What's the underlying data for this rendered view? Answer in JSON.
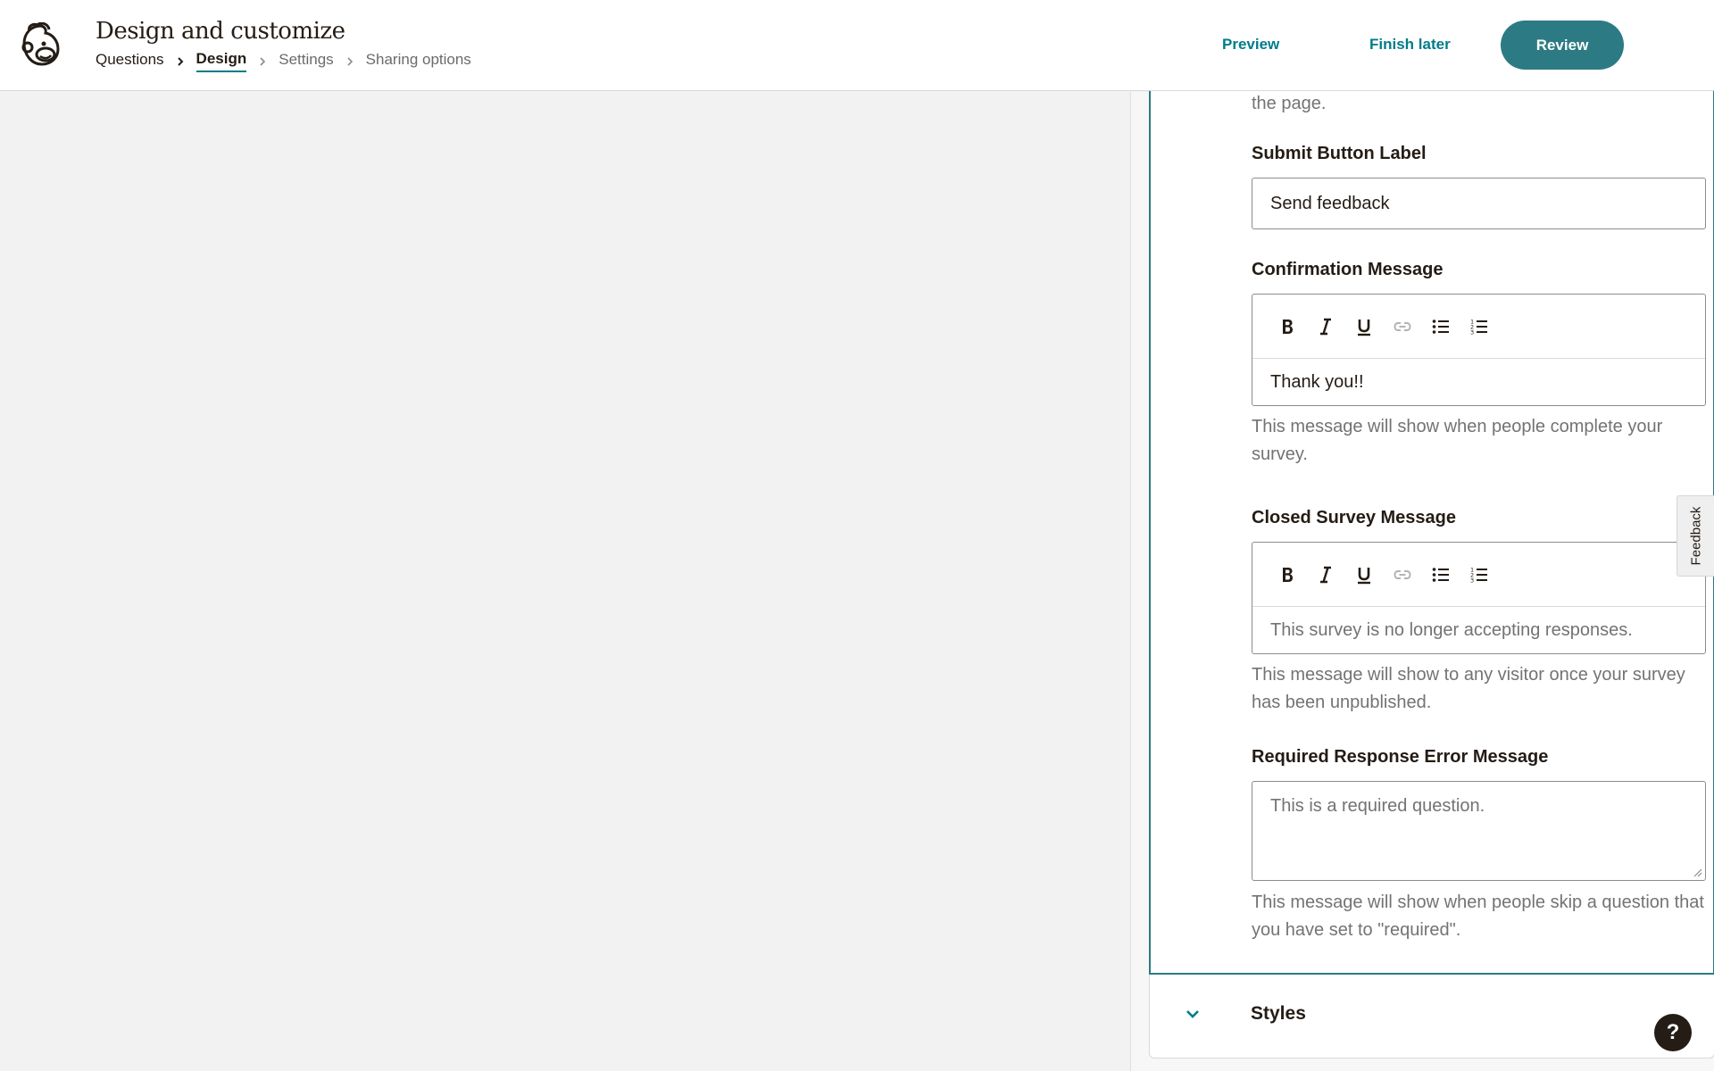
{
  "header": {
    "title": "Design and customize",
    "breadcrumbs": [
      "Questions",
      "Design",
      "Settings",
      "Sharing options"
    ],
    "preview_label": "Preview",
    "finish_later_label": "Finish later",
    "review_label": "Review"
  },
  "panel": {
    "intro_tail": "the page.",
    "submit_button": {
      "label": "Submit Button Label",
      "value": "Send feedback"
    },
    "confirmation": {
      "label": "Confirmation Message",
      "value": "Thank you!!",
      "help": "This message will show when people complete your survey."
    },
    "closed": {
      "label": "Closed Survey Message",
      "placeholder": "This survey is no longer accepting responses.",
      "help": "This message will show to any visitor once your survey has been unpublished."
    },
    "required_error": {
      "label": "Required Response Error Message",
      "placeholder": "This is a required question.",
      "help": "This message will show when people skip a question that you have set to \"required\"."
    },
    "styles_label": "Styles"
  },
  "toolbar_icons": [
    "bold-icon",
    "italic-icon",
    "underline-icon",
    "link-icon",
    "bulleted-list-icon",
    "numbered-list-icon"
  ],
  "feedback_tab_label": "Feedback",
  "help_button_label": "?",
  "colors": {
    "accent": "#007c89",
    "review_button": "#2c7a84",
    "text": "#241c15",
    "muted": "#737373",
    "canvas": "#f2f2f2"
  }
}
